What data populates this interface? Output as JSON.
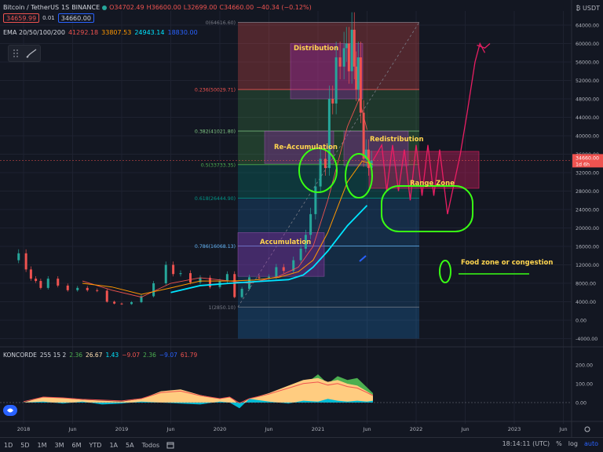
{
  "header": {
    "symbol": "Bitcoin / TetherUS",
    "interval": "1S",
    "exchange": "BINANCE",
    "open": "O34702.49",
    "high": "H36600.00",
    "low": "L32699.00",
    "close": "C34660.00",
    "change": "−40.34 (−0.12%)",
    "sell_price": "34659.99",
    "spread": "0.01",
    "buy_price": "34660.00",
    "ema_label": "EMA 20/50/100/200",
    "ema_values": [
      "41292.18",
      "33807.53",
      "24943.14",
      "18830.00"
    ],
    "ema_colors": [
      "#ef5350",
      "#ff9800",
      "#00e5ff",
      "#2962ff"
    ]
  },
  "top_right": "₿ USDT",
  "price_axis": {
    "ticks": [
      "64000.00",
      "60000.00",
      "56000.00",
      "52000.00",
      "48000.00",
      "44000.00",
      "40000.00",
      "36000.00",
      "32000.00",
      "28000.00",
      "24000.00",
      "20000.00",
      "16000.00",
      "12000.00",
      "8000.00",
      "4000.00",
      "0.00",
      "-4000.00"
    ],
    "current_price": "34660.00",
    "countdown": "1d 6h"
  },
  "time_axis": {
    "ticks": [
      "2018",
      "Jun",
      "2019",
      "Jun",
      "2020",
      "Jun",
      "2021",
      "Jun",
      "2022",
      "Jun",
      "2023",
      "Jun"
    ]
  },
  "fib": {
    "levels": [
      "0(64616.60)",
      "0.236(50029.71)",
      "0.382(41021.80)",
      "0.5(33733.35)",
      "0.618(26444.90)",
      "0.786(16068.13)",
      "1(2850.10)"
    ],
    "colors": [
      "#787b86",
      "#ef5350",
      "#81c784",
      "#4caf50",
      "#009688",
      "#64b5f6",
      "#787b86"
    ]
  },
  "annotations": {
    "distribution": "Distribution",
    "re_accumulation": "Re-Accumulation",
    "redistribution": "Redistribution",
    "range_zone": "Range Zone",
    "accumulation": "Accumulation",
    "food_zone": "Food zone or congestion"
  },
  "indicator": {
    "name": "KONCORDE",
    "params": "255 15 2",
    "values": [
      "2.36",
      "26.67",
      "1.43",
      "−9.07",
      "2.36",
      "−9.07",
      "61.79"
    ],
    "value_colors": [
      "#4caf50",
      "#ffe0b2",
      "#00e5ff",
      "#ef5350",
      "#4caf50",
      "#2962ff",
      "#ef5350"
    ],
    "axis_ticks": [
      "200.00",
      "100.00",
      "0.00"
    ]
  },
  "bottom_bar": {
    "timeframes": [
      "1D",
      "5D",
      "1M",
      "3M",
      "6M",
      "YTD",
      "1A",
      "5A",
      "Todos"
    ],
    "clock": "18:14:11 (UTC)",
    "percent": "%",
    "log": "log",
    "auto": "auto"
  }
}
